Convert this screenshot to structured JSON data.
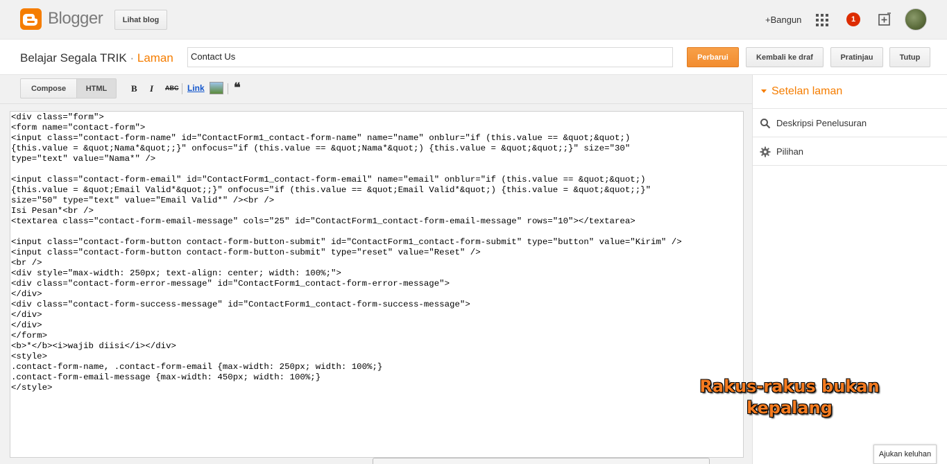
{
  "header": {
    "brand": "Blogger",
    "view_blog": "Lihat blog",
    "create": "+Bangun",
    "notification_count": "1"
  },
  "post": {
    "blog_title": "Belajar Segala TRIK",
    "separator": "·",
    "section": "Laman",
    "title_value": "Contact Us",
    "update_label": "Perbarui",
    "revert_label": "Kembali ke draf",
    "preview_label": "Pratinjau",
    "close_label": "Tutup"
  },
  "toolbar": {
    "compose_label": "Compose",
    "html_label": "HTML",
    "bold": "B",
    "italic": "I",
    "strike": "ABC",
    "link": "Link",
    "quote": "❝"
  },
  "editor": {
    "code": "<div class=\"form\">\n<form name=\"contact-form\">\n<input class=\"contact-form-name\" id=\"ContactForm1_contact-form-name\" name=\"name\" onblur=\"if (this.value == &quot;&quot;)\n{this.value = &quot;Nama*&quot;;}\" onfocus=\"if (this.value == &quot;Nama*&quot;) {this.value = &quot;&quot;;}\" size=\"30\"\ntype=\"text\" value=\"Nama*\" />\n\n<input class=\"contact-form-email\" id=\"ContactForm1_contact-form-email\" name=\"email\" onblur=\"if (this.value == &quot;&quot;)\n{this.value = &quot;Email Valid*&quot;;}\" onfocus=\"if (this.value == &quot;Email Valid*&quot;) {this.value = &quot;&quot;;}\"\nsize=\"50\" type=\"text\" value=\"Email Valid*\" /><br />\nIsi Pesan*<br />\n<textarea class=\"contact-form-email-message\" cols=\"25\" id=\"ContactForm1_contact-form-email-message\" rows=\"10\"></textarea>\n\n<input class=\"contact-form-button contact-form-button-submit\" id=\"ContactForm1_contact-form-submit\" type=\"button\" value=\"Kirim\" />\n<input class=\"contact-form-button contact-form-button-submit\" type=\"reset\" value=\"Reset\" />\n<br />\n<div style=\"max-width: 250px; text-align: center; width: 100%;\">\n<div class=\"contact-form-error-message\" id=\"ContactForm1_contact-form-error-message\">\n</div>\n<div class=\"contact-form-success-message\" id=\"ContactForm1_contact-form-success-message\">\n</div>\n</div>\n</form>\n<b>*</b><i>wajib diisi</i></div>\n<style>\n.contact-form-name, .contact-form-email {max-width: 250px; width: 100%;}\n.contact-form-email-message {max-width: 450px; width: 100%;}\n</style>"
  },
  "sidebar": {
    "heading": "Setelan laman",
    "items": [
      {
        "label": "Deskripsi Penelusuran",
        "icon": "search-icon"
      },
      {
        "label": "Pilihan",
        "icon": "gear-icon"
      }
    ]
  },
  "overlay": {
    "watermark_line1": "Rakus-rakus bukan",
    "watermark_line2": "kepalang",
    "feedback_label": "Ajukan keluhan"
  },
  "colors": {
    "brand_orange": "#f57d00",
    "update_button": "#f28c2f",
    "notification_red": "#dd2c00",
    "link_blue": "#1155cc"
  }
}
